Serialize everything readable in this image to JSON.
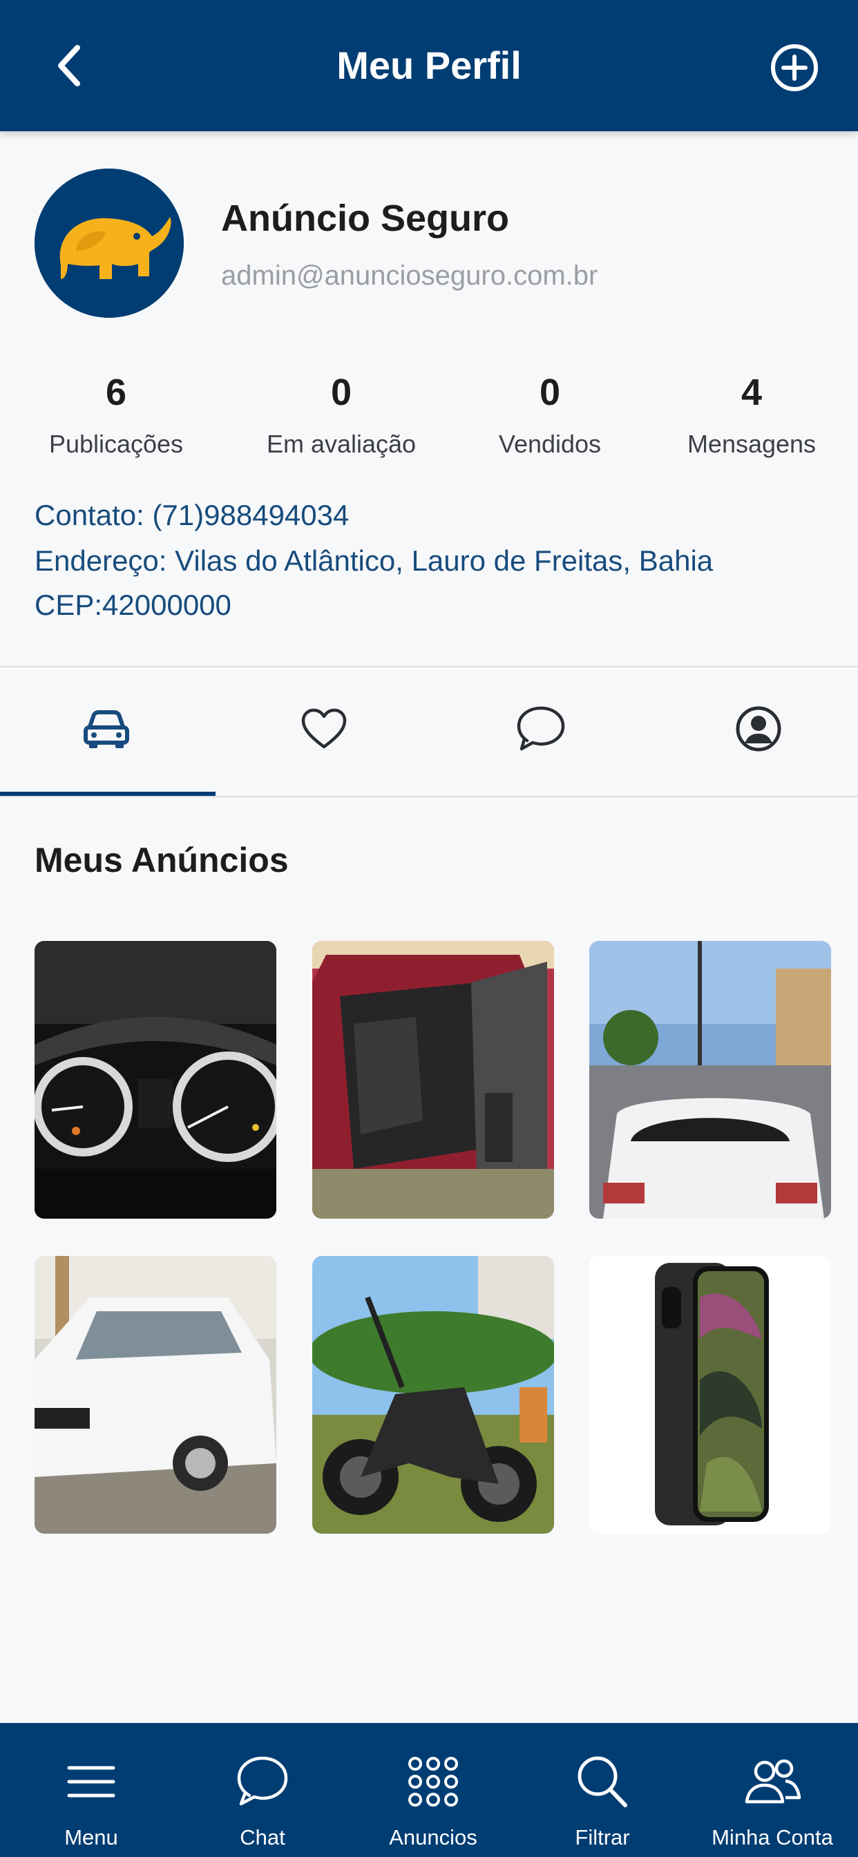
{
  "header": {
    "title": "Meu Perfil"
  },
  "profile": {
    "name": "Anúncio Seguro",
    "email": "admin@anuncioseguro.com.br"
  },
  "stats": [
    {
      "value": "6",
      "label": "Publicações"
    },
    {
      "value": "0",
      "label": "Em avaliação"
    },
    {
      "value": "0",
      "label": "Vendidos"
    },
    {
      "value": "4",
      "label": "Mensagens"
    }
  ],
  "info": {
    "contact": "Contato: (71)988494034",
    "address": "Endereço: Vilas do Atlântico, Lauro de Freitas, Bahia",
    "cep": "CEP:42000000"
  },
  "tabs": [
    {
      "icon": "car-icon",
      "active": true
    },
    {
      "icon": "heart-icon",
      "active": false
    },
    {
      "icon": "chat-icon",
      "active": false
    },
    {
      "icon": "user-circle-icon",
      "active": false
    }
  ],
  "section_title": "Meus Anúncios",
  "ads": [
    {
      "image": "car-dashboard-photo"
    },
    {
      "image": "red-car-interior-photo"
    },
    {
      "image": "white-toyota-street-photo"
    },
    {
      "image": "white-chevrolet-photo"
    },
    {
      "image": "black-motorcycle-photo"
    },
    {
      "image": "smartphone-photo"
    }
  ],
  "bottom_nav": [
    {
      "label": "Menu",
      "icon": "menu-icon"
    },
    {
      "label": "Chat",
      "icon": "chat-icon"
    },
    {
      "label": "Anuncios",
      "icon": "grid-icon"
    },
    {
      "label": "Filtrar",
      "icon": "search-icon"
    },
    {
      "label": "Minha Conta",
      "icon": "users-icon"
    }
  ],
  "colors": {
    "primary": "#003d73",
    "link": "#174b7d",
    "background": "#f7f8f9",
    "avatar_elephant": "#f7b21b"
  }
}
